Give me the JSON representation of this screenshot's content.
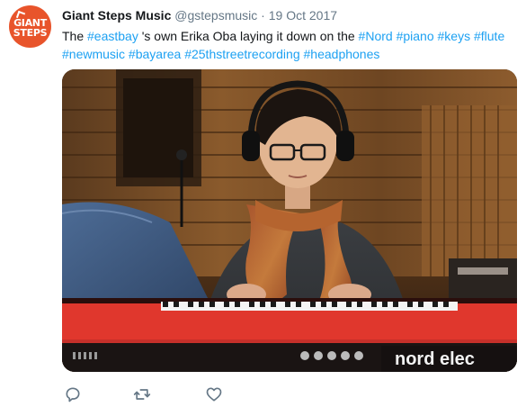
{
  "tweet": {
    "avatar": {
      "line1": "GIANT",
      "line2": "STEPS"
    },
    "author": {
      "name": "Giant Steps Music",
      "handle": "@gstepsmusic",
      "separator": "·",
      "date": "19 Oct 2017"
    },
    "text": {
      "w1": "The",
      "h1": "#eastbay",
      "w2": "'s own Erika Oba laying it down on the",
      "h2": "#Nord",
      "h3": "#piano",
      "h4": "#keys",
      "h5": "#flute",
      "h6": "#newmusic",
      "h7": "#bayarea",
      "h8": "#25thstreetrecording",
      "h9": "#headphones"
    },
    "media": {
      "keyboard_brand": "nord elec"
    },
    "actions": {
      "reply_icon": "reply-icon",
      "retweet_icon": "retweet-icon",
      "like_icon": "heart-icon"
    },
    "colors": {
      "hashtag": "#1da1f2",
      "muted": "#657786",
      "avatar_bg": "#e8542b",
      "keyboard_red": "#e0372d"
    }
  }
}
